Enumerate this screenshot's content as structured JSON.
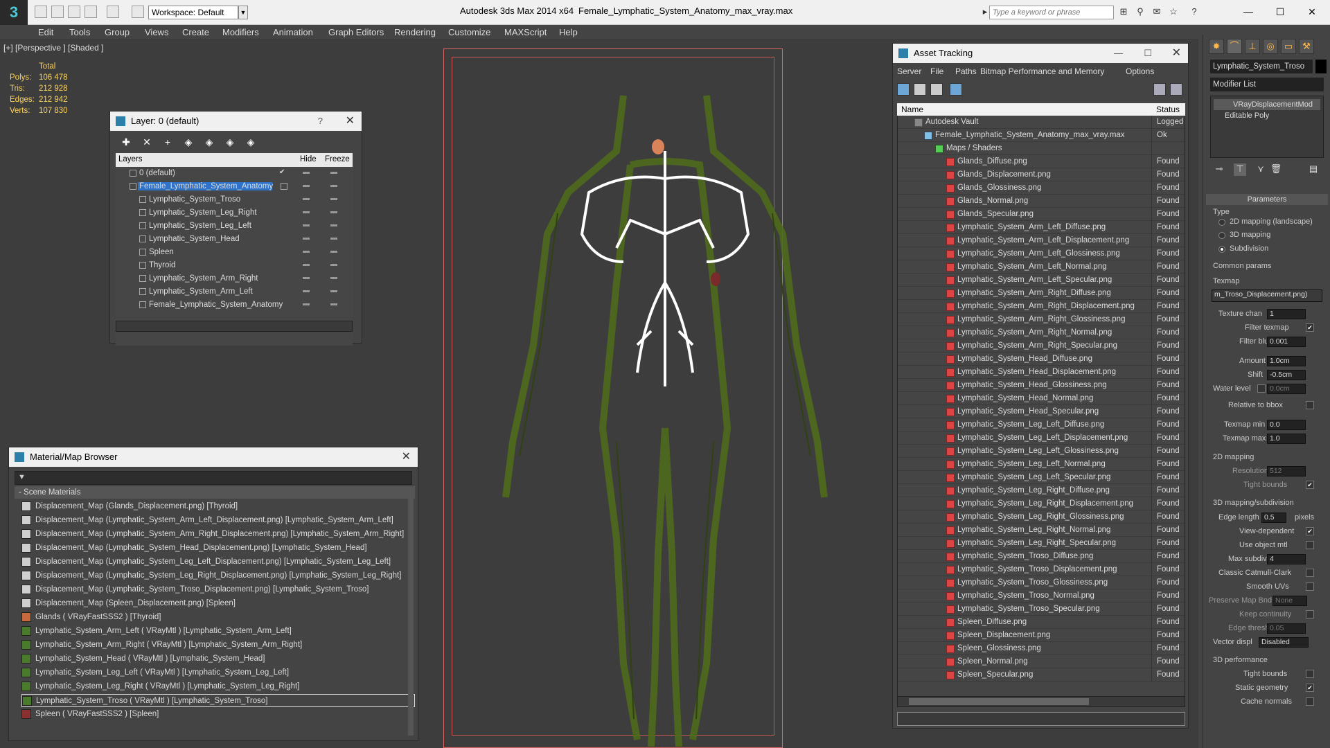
{
  "titlebar": {
    "workspace": "Workspace: Default",
    "app_title": "Autodesk 3ds Max  2014 x64",
    "file_title": "Female_Lymphatic_System_Anatomy_max_vray.max",
    "search_placeholder": "Type a keyword or phrase",
    "minimize": "—",
    "maximize": "☐",
    "close": "✕"
  },
  "menubar": [
    "Edit",
    "Tools",
    "Group",
    "Views",
    "Create",
    "Modifiers",
    "Animation",
    "Graph Editors",
    "Rendering",
    "Customize",
    "MAXScript",
    "Help"
  ],
  "viewport": {
    "label": "[+] [Perspective ] [Shaded ]",
    "stats": {
      "header": "Total",
      "rows": [
        {
          "label": "Polys:",
          "value": "106 478"
        },
        {
          "label": "Tris:",
          "value": "212 928"
        },
        {
          "label": "Edges:",
          "value": "212 942"
        },
        {
          "label": "Verts:",
          "value": "107 830"
        }
      ]
    }
  },
  "layer_panel": {
    "title": "Layer: 0 (default)",
    "help": "?",
    "close": "✕",
    "col_layers": "Layers",
    "col_hide": "Hide",
    "col_freeze": "Freeze",
    "rows": [
      {
        "name": "0 (default)"
      },
      {
        "name": "Female_Lymphatic_System_Anatomy"
      },
      {
        "name": "Lymphatic_System_Troso"
      },
      {
        "name": "Lymphatic_System_Leg_Right"
      },
      {
        "name": "Lymphatic_System_Leg_Left"
      },
      {
        "name": "Lymphatic_System_Head"
      },
      {
        "name": "Spleen"
      },
      {
        "name": "Thyroid"
      },
      {
        "name": "Lymphatic_System_Arm_Right"
      },
      {
        "name": "Lymphatic_System_Arm_Left"
      },
      {
        "name": "Female_Lymphatic_System_Anatomy"
      }
    ]
  },
  "material_browser": {
    "title": "Material/Map Browser",
    "close": "✕",
    "section": "- Scene Materials",
    "items": [
      {
        "text": "Displacement_Map (Glands_Displacement.png) [Thyroid]",
        "color": "#cfcfcf"
      },
      {
        "text": "Displacement_Map (Lymphatic_System_Arm_Left_Displacement.png) [Lymphatic_System_Arm_Left]",
        "color": "#cfcfcf"
      },
      {
        "text": "Displacement_Map (Lymphatic_System_Arm_Right_Displacement.png) [Lymphatic_System_Arm_Right]",
        "color": "#cfcfcf"
      },
      {
        "text": "Displacement_Map (Lymphatic_System_Head_Displacement.png) [Lymphatic_System_Head]",
        "color": "#cfcfcf"
      },
      {
        "text": "Displacement_Map (Lymphatic_System_Leg_Left_Displacement.png) [Lymphatic_System_Leg_Left]",
        "color": "#cfcfcf"
      },
      {
        "text": "Displacement_Map (Lymphatic_System_Leg_Right_Displacement.png) [Lymphatic_System_Leg_Right]",
        "color": "#cfcfcf"
      },
      {
        "text": "Displacement_Map (Lymphatic_System_Troso_Displacement.png) [Lymphatic_System_Troso]",
        "color": "#cfcfcf"
      },
      {
        "text": "Displacement_Map (Spleen_Displacement.png) [Spleen]",
        "color": "#cfcfcf"
      },
      {
        "text": "Glands  ( VRayFastSSS2 )  [Thyroid]",
        "color": "#c86a3c"
      },
      {
        "text": "Lymphatic_System_Arm_Left  ( VRayMtl )  [Lymphatic_System_Arm_Left]",
        "color": "#4a7a2c"
      },
      {
        "text": "Lymphatic_System_Arm_Right  ( VRayMtl )  [Lymphatic_System_Arm_Right]",
        "color": "#4a7a2c"
      },
      {
        "text": "Lymphatic_System_Head  ( VRayMtl )  [Lymphatic_System_Head]",
        "color": "#4a7a2c"
      },
      {
        "text": "Lymphatic_System_Leg_Left  ( VRayMtl )  [Lymphatic_System_Leg_Left]",
        "color": "#4a7a2c"
      },
      {
        "text": "Lymphatic_System_Leg_Right  ( VRayMtl )  [Lymphatic_System_Leg_Right]",
        "color": "#4a7a2c"
      },
      {
        "text": "Lymphatic_System_Troso  ( VRayMtl )  [Lymphatic_System_Troso]",
        "color": "#4a7a2c"
      },
      {
        "text": "Spleen  ( VRayFastSSS2 )  [Spleen]",
        "color": "#8a3030"
      }
    ]
  },
  "asset_tracking": {
    "title": "Asset Tracking",
    "minimize": "—",
    "maximize": "☐",
    "close": "✕",
    "menu": [
      "Server",
      "File",
      "Paths",
      "Bitmap Performance and Memory",
      "Options"
    ],
    "col_name": "Name",
    "col_status": "Status",
    "vault": {
      "name": "Autodesk Vault",
      "status": "Logged O"
    },
    "maxfile": {
      "name": "Female_Lymphatic_System_Anatomy_max_vray.max",
      "status": "Ok"
    },
    "maps_folder": "Maps / Shaders",
    "files": [
      "Glands_Diffuse.png",
      "Glands_Displacement.png",
      "Glands_Glossiness.png",
      "Glands_Normal.png",
      "Glands_Specular.png",
      "Lymphatic_System_Arm_Left_Diffuse.png",
      "Lymphatic_System_Arm_Left_Displacement.png",
      "Lymphatic_System_Arm_Left_Glossiness.png",
      "Lymphatic_System_Arm_Left_Normal.png",
      "Lymphatic_System_Arm_Left_Specular.png",
      "Lymphatic_System_Arm_Right_Diffuse.png",
      "Lymphatic_System_Arm_Right_Displacement.png",
      "Lymphatic_System_Arm_Right_Glossiness.png",
      "Lymphatic_System_Arm_Right_Normal.png",
      "Lymphatic_System_Arm_Right_Specular.png",
      "Lymphatic_System_Head_Diffuse.png",
      "Lymphatic_System_Head_Displacement.png",
      "Lymphatic_System_Head_Glossiness.png",
      "Lymphatic_System_Head_Normal.png",
      "Lymphatic_System_Head_Specular.png",
      "Lymphatic_System_Leg_Left_Diffuse.png",
      "Lymphatic_System_Leg_Left_Displacement.png",
      "Lymphatic_System_Leg_Left_Glossiness.png",
      "Lymphatic_System_Leg_Left_Normal.png",
      "Lymphatic_System_Leg_Left_Specular.png",
      "Lymphatic_System_Leg_Right_Diffuse.png",
      "Lymphatic_System_Leg_Right_Displacement.png",
      "Lymphatic_System_Leg_Right_Glossiness.png",
      "Lymphatic_System_Leg_Right_Normal.png",
      "Lymphatic_System_Leg_Right_Specular.png",
      "Lymphatic_System_Troso_Diffuse.png",
      "Lymphatic_System_Troso_Displacement.png",
      "Lymphatic_System_Troso_Glossiness.png",
      "Lymphatic_System_Troso_Normal.png",
      "Lymphatic_System_Troso_Specular.png",
      "Spleen_Diffuse.png",
      "Spleen_Displacement.png",
      "Spleen_Glossiness.png",
      "Spleen_Normal.png",
      "Spleen_Specular.png"
    ],
    "file_status": "Found"
  },
  "command_panel": {
    "object_name": "Lymphatic_System_Troso",
    "modifier_list": "Modifier List",
    "stack": [
      "VRayDisplacementMod",
      "Editable Poly"
    ],
    "parameters": "Parameters",
    "type_label": "Type",
    "type_options": [
      {
        "label": "2D mapping (landscape)",
        "on": false
      },
      {
        "label": "3D mapping",
        "on": false
      },
      {
        "label": "Subdivision",
        "on": true
      }
    ],
    "common_params": "Common params",
    "texmap_label": "Texmap",
    "texmap_value": "m_Troso_Displacement.png)",
    "texture_chan_label": "Texture chan",
    "texture_chan_value": "1",
    "filter_texmap": "Filter texmap",
    "filter_blur_label": "Filter blur",
    "filter_blur_value": "0.001",
    "amount_label": "Amount",
    "amount_value": "1.0cm",
    "shift_label": "Shift",
    "shift_value": "-0.5cm",
    "water_level_label": "Water level",
    "water_level_value": "0.0cm",
    "relative_bbox": "Relative to bbox",
    "texmap_min_label": "Texmap min",
    "texmap_min_value": "0.0",
    "texmap_max_label": "Texmap max",
    "texmap_max_value": "1.0",
    "mapping2d": "2D mapping",
    "resolution_label": "Resolution",
    "resolution_value": "512",
    "tight_bounds": "Tight bounds",
    "mapping3d": "3D mapping/subdivision",
    "edge_length_label": "Edge length",
    "edge_length_value": "0.5",
    "pixels": "pixels",
    "view_dependent": "View-dependent",
    "use_object_mtl": "Use object mtl",
    "max_subdivs_label": "Max subdivs",
    "max_subdivs_value": "4",
    "classic_catmull": "Classic Catmull-Clark",
    "smooth_uvs": "Smooth UVs",
    "preserve_map_label": "Preserve Map Bnd",
    "preserve_map_value": "None",
    "keep_continuity": "Keep continuity",
    "edge_thresh_label": "Edge thresh",
    "edge_thresh_value": "0.05",
    "vector_displ_label": "Vector displ",
    "vector_displ_value": "Disabled",
    "perf3d": "3D performance",
    "tight_bounds2": "Tight bounds",
    "static_geometry": "Static geometry",
    "cache_normals": "Cache normals"
  }
}
